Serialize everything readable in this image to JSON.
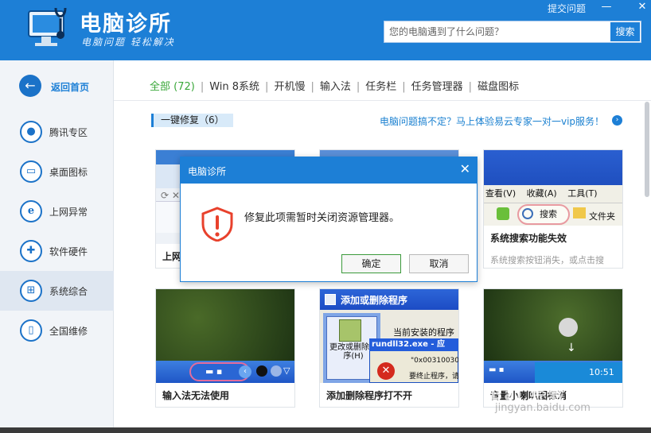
{
  "header": {
    "title": "电脑诊所",
    "slogan": "电脑问题 轻松解决",
    "feedback": "提交问题",
    "search_placeholder": "您的电脑遇到了什么问题？",
    "search_button": "搜索"
  },
  "sidebar": {
    "home": "返回首页",
    "items": [
      {
        "label": "腾讯专区",
        "icon": "penguin-icon"
      },
      {
        "label": "桌面图标",
        "icon": "monitor-icon"
      },
      {
        "label": "上网异常",
        "icon": "ie-icon"
      },
      {
        "label": "软件硬件",
        "icon": "cross-icon"
      },
      {
        "label": "系统综合",
        "icon": "windows-icon"
      },
      {
        "label": "全国维修",
        "icon": "phone-icon"
      }
    ],
    "active_index": 4
  },
  "tabs": [
    {
      "label": "全部 (72)",
      "active": true
    },
    {
      "label": "Win 8系统"
    },
    {
      "label": "开机慢"
    },
    {
      "label": "输入法"
    },
    {
      "label": "任务栏"
    },
    {
      "label": "任务管理器"
    },
    {
      "label": "磁盘图标"
    }
  ],
  "section": {
    "title": "一键修复（6）",
    "promo": "电脑问题搞不定？马上体验易云专家一对一vip服务！"
  },
  "cards": [
    {
      "title": "上网",
      "desc": ""
    },
    {
      "title": "",
      "desc": ""
    },
    {
      "title": "系统搜索功能失效",
      "desc": "系统搜索按钮消失，或点击搜"
    },
    {
      "title": "输入法无法使用",
      "desc": ""
    },
    {
      "title": "添加删除程序打不开",
      "desc": ""
    },
    {
      "title": "音量小喇叭图标消",
      "desc": ""
    }
  ],
  "thumbs": {
    "ie_menu": [
      "查看(V)",
      "收藏(A)",
      "工具(T)"
    ],
    "search_label": "搜索",
    "folder_label": "文件夹",
    "addremove_title": "添加或删除程序",
    "current_installed": "当前安装的程序",
    "change_remove": "更改或删除程序(H)",
    "error_title": "rundll32.exe - 应",
    "error_code": "\"0x00310030\"",
    "error_line": "要终止程序，请",
    "clock": "10:51"
  },
  "dialog": {
    "title": "电脑诊所",
    "message": "修复此项需暂时关闭资源管理器。",
    "ok": "确定",
    "cancel": "取消"
  },
  "watermark": {
    "text": "Bai 经验",
    "url": "jingyan.baidu.com"
  },
  "colors": {
    "brand_blue": "#1d7fd6",
    "active_tab_green": "#3aa73a",
    "warning_red": "#e8412c"
  }
}
